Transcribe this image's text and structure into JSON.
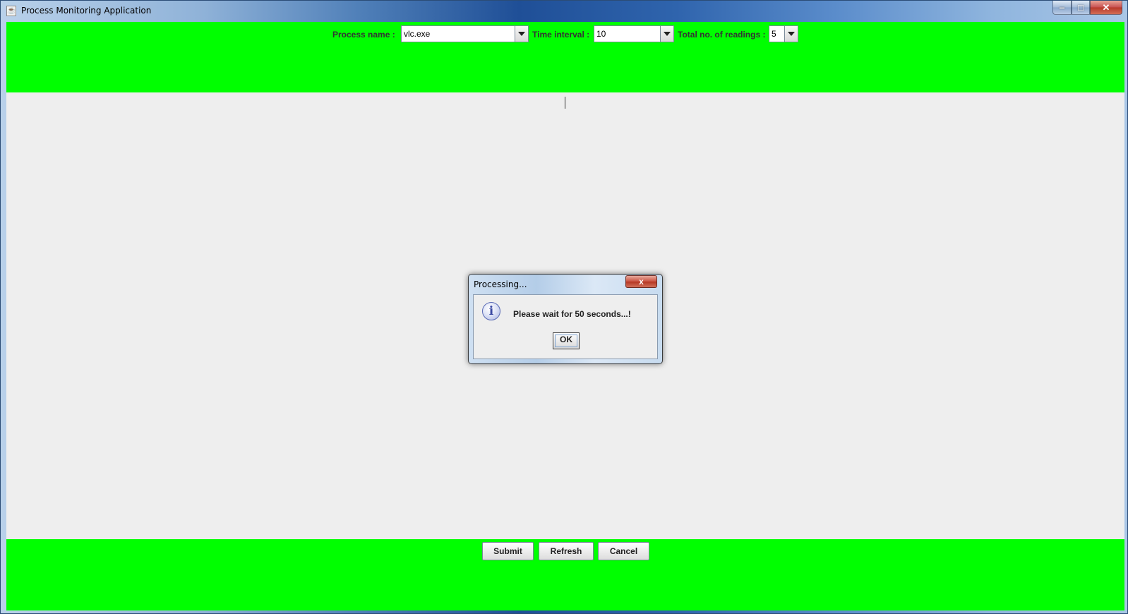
{
  "window": {
    "title": "Process Monitoring Application",
    "controls": {
      "minimize": "‒",
      "maximize": "□",
      "close": "✕"
    }
  },
  "top_panel": {
    "process_label": "Process name :",
    "process_value": "vlc.exe",
    "interval_label": "Time interval :",
    "interval_value": "10",
    "readings_label": "Total no. of readings :",
    "readings_value": "5"
  },
  "bottom_panel": {
    "submit": "Submit",
    "refresh": "Refresh",
    "cancel": "Cancel"
  },
  "dialog": {
    "title": "Processing...",
    "close": "x",
    "icon": "i",
    "message": "Please wait for 50 seconds...!",
    "ok": "OK"
  },
  "colors": {
    "panel_green": "#00ff00",
    "content_bg": "#eeeeee"
  }
}
